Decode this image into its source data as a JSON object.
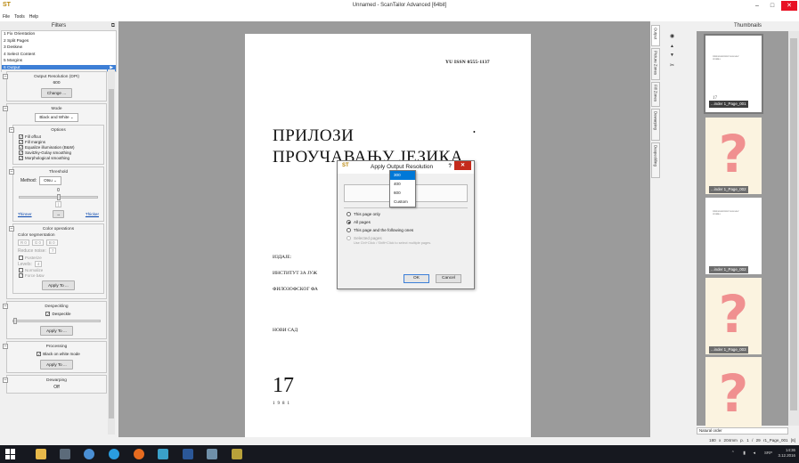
{
  "window": {
    "title": "Unnamed - ScanTailor Advanced [64bit]",
    "controls": {
      "minimize": "–",
      "maximize": "□",
      "close": "✕"
    }
  },
  "menu": [
    "File",
    "Tools",
    "Help"
  ],
  "filters": {
    "header": "Filters",
    "items": [
      {
        "label": "1 Fix Orientation"
      },
      {
        "label": "2 Split Pages"
      },
      {
        "label": "3 Deskew"
      },
      {
        "label": "4 Select Content"
      },
      {
        "label": "5 Margins"
      },
      {
        "label": "6 Output"
      }
    ],
    "active_index": 5
  },
  "output_options": {
    "resolution": {
      "title": "Output Resolution (DPI)",
      "value": "600",
      "change_button": "Change ..."
    },
    "mode": {
      "title": "Mode",
      "selected": "Black and White",
      "options_title": "Options",
      "checkboxes": [
        {
          "label": "Fill offcut",
          "checked": true
        },
        {
          "label": "Fill margins",
          "checked": true
        },
        {
          "label": "Equalize illumination (B&W)",
          "checked": true
        },
        {
          "label": "Savitzky-Golay smoothing",
          "checked": true
        },
        {
          "label": "Morphological smoothing",
          "checked": true
        }
      ]
    },
    "threshold": {
      "title": "Threshold",
      "method_label": "Method:",
      "method_value": "Otsu",
      "value": "0",
      "thinner": "Thinner",
      "thicker": "Thicker",
      "reset": "↔"
    },
    "color_operations": {
      "title": "Color operations",
      "segmentation_label": "Color segmentation",
      "rgb": [
        "R 0",
        "G 0",
        "B 0"
      ],
      "reduce_noise_label": "Reduce noise:",
      "reduce_noise_value": "7",
      "posterize_label": "Posterize",
      "levels_label": "Levels:",
      "levels_value": "4",
      "normalize_label": "Normalize",
      "force_bw_label": "Force b&w",
      "apply": "Apply To ..."
    },
    "despeckling": {
      "title": "Despeckling",
      "checkbox": "Despeckle",
      "apply": "Apply To ..."
    },
    "processing": {
      "title": "Processing",
      "checkbox": "Black on white mode",
      "apply": "Apply To ..."
    },
    "dewarping": {
      "title": "Dewarping",
      "value": "Off"
    }
  },
  "document": {
    "issn": "YU ISSN 0555-1137",
    "title_line1": "ПРИЛОЗИ",
    "title_line2": "ПРОУЧАВАЊУ ЈЕЗИКА",
    "publisher_label": "ИЗДАЈЕ:",
    "publisher_line1": "ИНСТИТУТ ЗА ЈУЖ",
    "publisher_line2": "ФИЛОЗОФСКОГ ФА",
    "city": "НОВИ САД",
    "volume": "17",
    "year": "1981"
  },
  "dialog": {
    "title": "Apply Output Resolution",
    "help": "?",
    "close": "✕",
    "scope": [
      {
        "label": "This page only",
        "selected": false
      },
      {
        "label": "All pages",
        "selected": true
      },
      {
        "label": "This page and the following ones",
        "selected": false
      },
      {
        "label": "Selected pages",
        "selected": false,
        "disabled": true
      }
    ],
    "selected_hint": "Use Ctrl+Click / Shift+Click to select multiple pages.",
    "ok": "OK",
    "cancel": "Cancel",
    "dropdown": {
      "options": [
        "300",
        "400",
        "600",
        "Custom"
      ],
      "highlighted": "300"
    }
  },
  "side_tabs": [
    "Output",
    "Picture Zones",
    "Fill Zones",
    "Dewarping",
    "Despeckling"
  ],
  "nav_icons": [
    {
      "name": "eye-icon",
      "glyph": "◉"
    },
    {
      "name": "arrow-up-icon",
      "glyph": "▲"
    },
    {
      "name": "arrow-down-icon",
      "glyph": "▼"
    },
    {
      "name": "scissors-icon",
      "glyph": "✂"
    }
  ],
  "thumbnails": {
    "header": "Thumbnails",
    "items": [
      {
        "label": "...inder 1_Page_001",
        "missing": false,
        "current": true
      },
      {
        "label": "...inder 1_Page_002",
        "missing": true
      },
      {
        "label": "...inder 1_Page_002",
        "missing": false
      },
      {
        "label": "...inder 1_Page_003",
        "missing": true
      },
      {
        "label": "",
        "missing": true
      }
    ],
    "sort": "Natural order",
    "mini_text": "ПРИЛОЗИ ПРОУЧАВАЊУ ЈЕЗИКА",
    "mini_vol": "17"
  },
  "status": {
    "info": "180 x 204mm p. 1 / 29 r1_Page_001 [6]"
  },
  "taskbar": {
    "tray_lang": "SRP",
    "time": "14:36",
    "date": "3.12.2016"
  },
  "colors": {
    "accent": "#3d7fd6",
    "canvas": "#9b9b9b",
    "close_red": "#c42b1c"
  }
}
